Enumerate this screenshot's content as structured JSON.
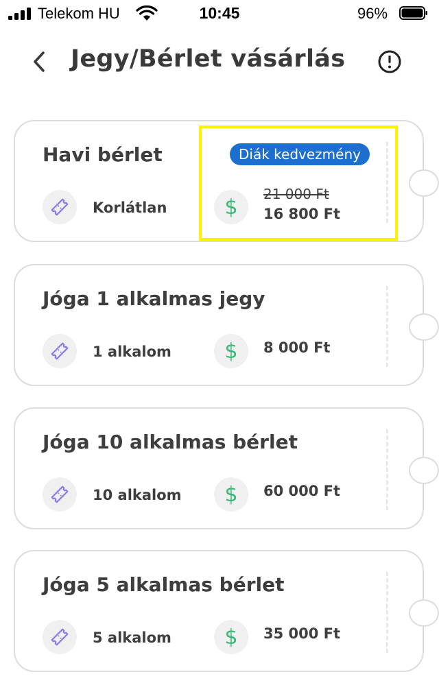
{
  "status_bar": {
    "carrier": "Telekom HU",
    "time": "10:45",
    "battery": "96%"
  },
  "header": {
    "title": "Jegy/Bérlet vásárlás",
    "back_icon": "chevron-left-icon",
    "info_icon": "exclamation-circle-icon"
  },
  "colors": {
    "badge": "#1d6fcf",
    "dollar": "#3cb878",
    "ticket_icon": "#8a7ae8",
    "highlight": "#fff200"
  },
  "products": [
    {
      "title": "Havi bérlet",
      "quantity": "Korlátlan",
      "badge": "Diák kedvezmény",
      "old_price": "21 000 Ft",
      "price": "16 800 Ft"
    },
    {
      "title": "Jóga 1 alkalmas jegy",
      "quantity": "1 alkalom",
      "price": "8 000 Ft"
    },
    {
      "title": "Jóga 10 alkalmas bérlet",
      "quantity": "10 alkalom",
      "price": "60 000 Ft"
    },
    {
      "title": "Jóga 5 alkalmas bérlet",
      "quantity": "5 alkalom",
      "price": "35 000 Ft"
    }
  ],
  "icons": {
    "ticket": "ticket-icon",
    "price": "dollar-icon"
  }
}
